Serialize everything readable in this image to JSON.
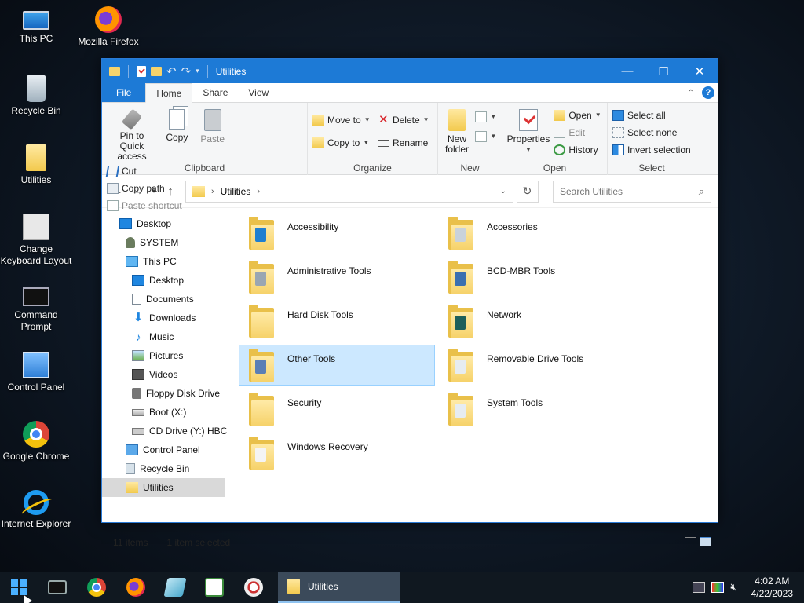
{
  "desktop": {
    "icons": [
      {
        "label": "This PC",
        "icon": "computer-icon"
      },
      {
        "label": "Mozilla Firefox",
        "icon": "firefox-icon"
      },
      {
        "label": "Recycle Bin",
        "icon": "recycle-bin-icon"
      },
      {
        "label": "Utilities",
        "icon": "folder-icon"
      },
      {
        "label": "Change Keyboard Layout",
        "icon": "keyboard-settings-icon"
      },
      {
        "label": "Command Prompt",
        "icon": "command-prompt-icon"
      },
      {
        "label": "Control Panel",
        "icon": "control-panel-icon"
      },
      {
        "label": "Google Chrome",
        "icon": "chrome-icon"
      },
      {
        "label": "Internet Explorer",
        "icon": "internet-explorer-icon"
      }
    ]
  },
  "window": {
    "title": "Utilities",
    "controls": {
      "minimize": "—",
      "maximize": "☐",
      "close": "✕"
    },
    "tabs": {
      "file": "File",
      "home": "Home",
      "share": "Share",
      "view": "View"
    },
    "ribbon": {
      "clipboard": {
        "label": "Clipboard",
        "pin": "Pin to Quick access",
        "copy": "Copy",
        "paste": "Paste",
        "cut": "Cut",
        "copy_path": "Copy path",
        "paste_shortcut": "Paste shortcut"
      },
      "organize": {
        "label": "Organize",
        "move_to": "Move to",
        "copy_to": "Copy to",
        "delete": "Delete",
        "rename": "Rename"
      },
      "new": {
        "label": "New",
        "new_folder": "New folder"
      },
      "open": {
        "label": "Open",
        "properties": "Properties",
        "open": "Open",
        "edit": "Edit",
        "history": "History"
      },
      "select": {
        "label": "Select",
        "select_all": "Select all",
        "select_none": "Select none",
        "invert": "Invert selection"
      }
    },
    "address": {
      "path": "Utilities"
    },
    "search": {
      "placeholder": "Search Utilities"
    },
    "nav_pane": [
      {
        "label": "Desktop",
        "icon": "desktop-icon",
        "indent": 0
      },
      {
        "label": "SYSTEM",
        "icon": "user-icon",
        "indent": 1
      },
      {
        "label": "This PC",
        "icon": "computer-icon",
        "indent": 1
      },
      {
        "label": "Desktop",
        "icon": "desktop-icon",
        "indent": 2
      },
      {
        "label": "Documents",
        "icon": "documents-icon",
        "indent": 2
      },
      {
        "label": "Downloads",
        "icon": "downloads-icon",
        "indent": 2
      },
      {
        "label": "Music",
        "icon": "music-icon",
        "indent": 2
      },
      {
        "label": "Pictures",
        "icon": "pictures-icon",
        "indent": 2
      },
      {
        "label": "Videos",
        "icon": "videos-icon",
        "indent": 2
      },
      {
        "label": "Floppy Disk Drive",
        "icon": "floppy-icon",
        "indent": 2
      },
      {
        "label": "Boot (X:)",
        "icon": "drive-icon",
        "indent": 2
      },
      {
        "label": "CD Drive (Y:) HBC",
        "icon": "cd-drive-icon",
        "indent": 2
      },
      {
        "label": "Control Panel",
        "icon": "control-panel-icon",
        "indent": 1
      },
      {
        "label": "Recycle Bin",
        "icon": "recycle-bin-icon",
        "indent": 1
      },
      {
        "label": "Utilities",
        "icon": "folder-icon",
        "indent": 1,
        "selected": true
      }
    ],
    "items": [
      {
        "label": "Accessibility",
        "badge": "#1f7fd0"
      },
      {
        "label": "Accessories",
        "badge": "#c9d2da"
      },
      {
        "label": "Administrative Tools",
        "badge": "#9aa6b2"
      },
      {
        "label": "BCD-MBR Tools",
        "badge": "#3b6fb0"
      },
      {
        "label": "Hard Disk Tools",
        "badge": ""
      },
      {
        "label": "Network",
        "badge": "#1d5f5a"
      },
      {
        "label": "Other Tools",
        "badge": "#5b7fb5",
        "selected": true
      },
      {
        "label": "Removable Drive Tools",
        "badge": "#e6ecf1"
      },
      {
        "label": "Security",
        "badge": ""
      },
      {
        "label": "System Tools",
        "badge": "#e6ecf1"
      },
      {
        "label": "Windows Recovery",
        "badge": "#f4f4f4"
      }
    ],
    "status": {
      "count": "11 items",
      "selected": "1 item selected"
    }
  },
  "taskbar": {
    "apps": [
      "command-prompt-icon",
      "chrome-icon",
      "firefox-icon",
      "glass-icon",
      "chart-icon",
      "paint-icon"
    ],
    "open_window": "Utilities",
    "clock": {
      "time": "4:02 AM",
      "date": "4/22/2023"
    }
  }
}
